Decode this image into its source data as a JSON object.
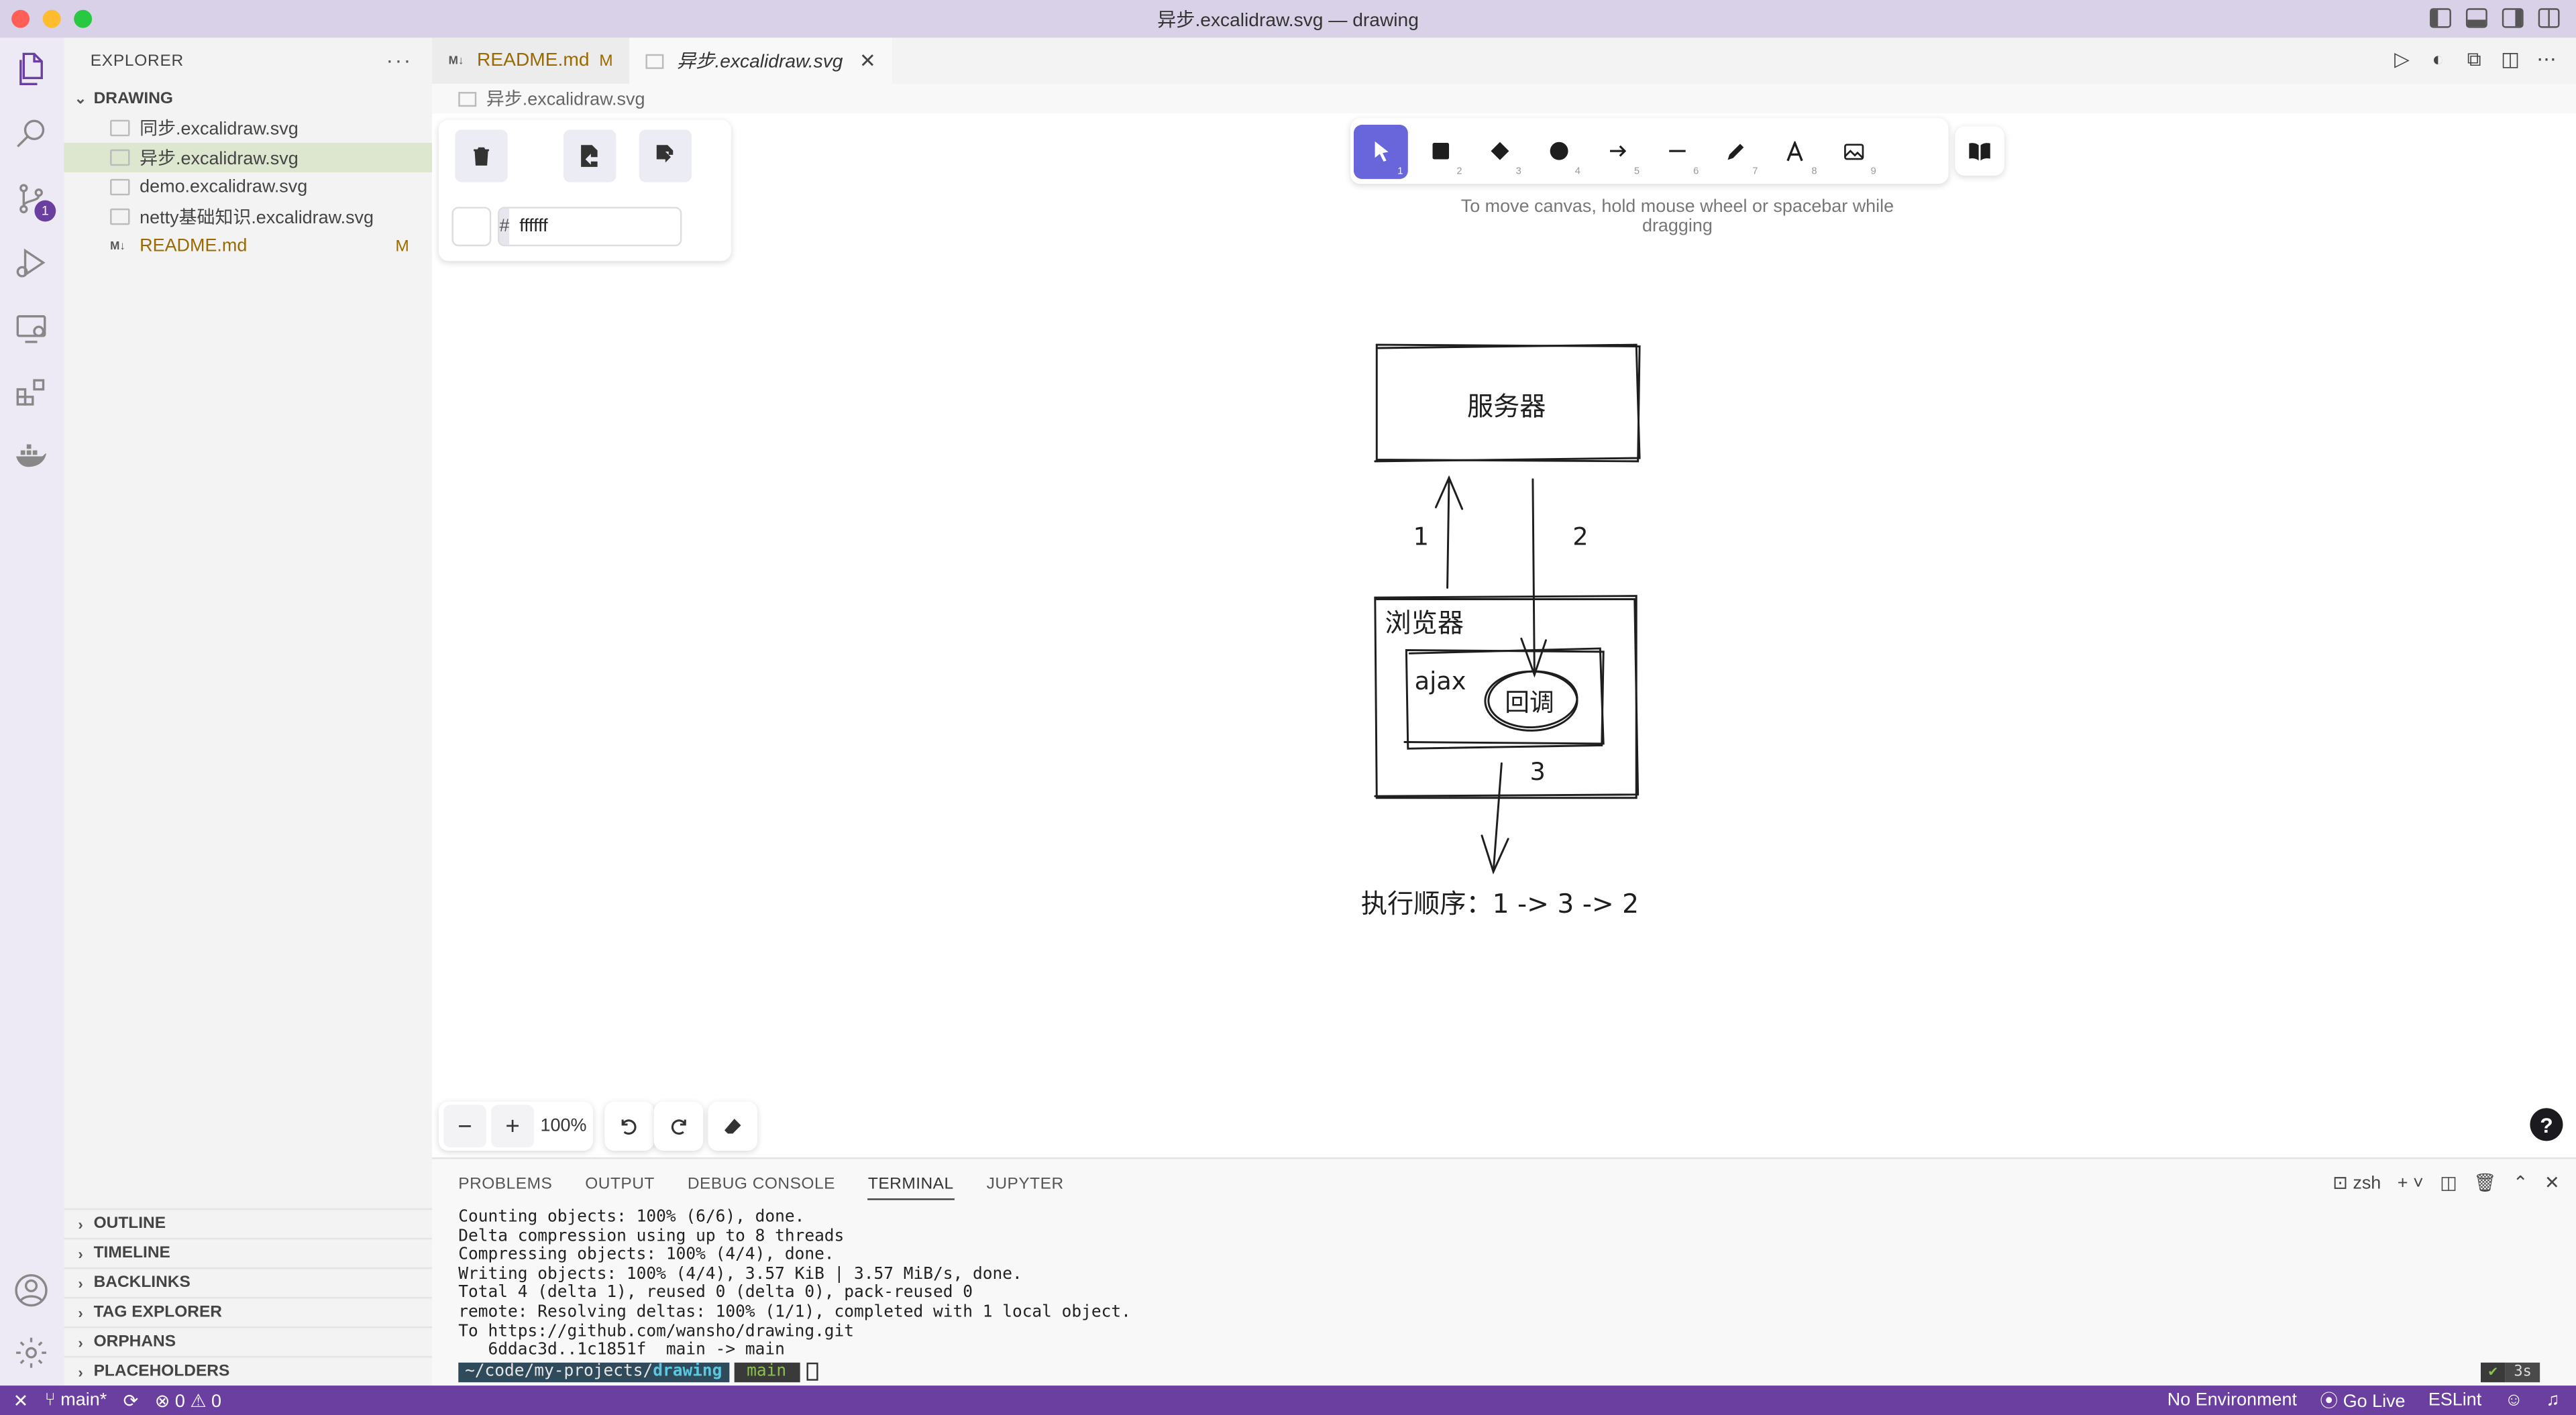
{
  "window": {
    "title": "异步.excalidraw.svg — drawing"
  },
  "activitybar": {
    "scm_badge": "1"
  },
  "sidebar": {
    "header": "EXPLORER",
    "more": "···",
    "folder": "DRAWING",
    "files": [
      {
        "name": "同步.excalidraw.svg"
      },
      {
        "name": "异步.excalidraw.svg"
      },
      {
        "name": "demo.excalidraw.svg"
      },
      {
        "name": "netty基础知识.excalidraw.svg"
      },
      {
        "name": "README.md",
        "flag": "M"
      }
    ],
    "md_badge": "M↓",
    "sections": [
      "OUTLINE",
      "TIMELINE",
      "BACKLINKS",
      "TAG EXPLORER",
      "ORPHANS",
      "PLACEHOLDERS"
    ]
  },
  "tabs": [
    {
      "label": "README.md",
      "flag": "M"
    },
    {
      "label": "异步.excalidraw.svg"
    }
  ],
  "breadcrumb": "异步.excalidraw.svg",
  "excalidraw": {
    "hex_prefix": "#",
    "bg_color": "ffffff",
    "tool_numbers": [
      "1",
      "2",
      "3",
      "4",
      "5",
      "6",
      "7",
      "8",
      "9"
    ],
    "hint": "To move canvas, hold mouse wheel or spacebar while dragging",
    "zoom": "100%",
    "zoom_minus": "−",
    "zoom_plus": "+",
    "help": "?"
  },
  "diagram": {
    "server": "服务器",
    "browser": "浏览器",
    "ajax": "ajax",
    "callback": "回调",
    "label1": "1",
    "label2": "2",
    "label3": "3",
    "order": "执行顺序：1 -> 3 -> 2"
  },
  "panel": {
    "tabs": [
      "PROBLEMS",
      "OUTPUT",
      "DEBUG CONSOLE",
      "TERMINAL",
      "JUPYTER"
    ],
    "shell": "zsh",
    "terminal_lines": [
      "Counting objects: 100% (6/6), done.",
      "Delta compression using up to 8 threads",
      "Compressing objects: 100% (4/4), done.",
      "Writing objects: 100% (4/4), 3.57 KiB | 3.57 MiB/s, done.",
      "Total 4 (delta 1), reused 0 (delta 0), pack-reused 0",
      "remote: Resolving deltas: 100% (1/1), completed with 1 local object.",
      "To https://github.com/wansho/drawing.git",
      "   6ddac3d..1c1851f  main -> main"
    ],
    "prompt_path": "~/code/my-projects/",
    "prompt_dir": "drawing",
    "prompt_branch": "main",
    "status_ok": "✔",
    "status_time": "3s"
  },
  "statusbar": {
    "branch": "main*",
    "errors": "0",
    "warnings": "0",
    "environment": "No Environment",
    "golive": "Go Live",
    "eslint": "ESLint"
  }
}
